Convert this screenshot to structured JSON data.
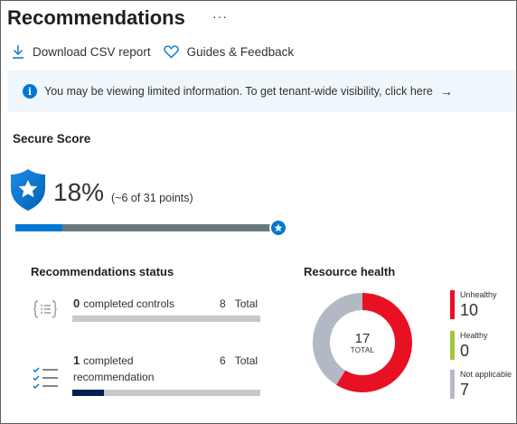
{
  "header": {
    "title": "Recommendations",
    "more_label": "···"
  },
  "toolbar": {
    "download_label": "Download CSV report",
    "guides_label": "Guides & Feedback"
  },
  "banner": {
    "info_glyph": "i",
    "text": "You may be viewing limited information. To get tenant-wide visibility, click here",
    "arrow": "→"
  },
  "secure_score": {
    "title": "Secure Score",
    "percent_label": "18%",
    "points_label": "(~6 of 31 points)",
    "progress_fraction": 0.18,
    "bar_color": "#0078d4",
    "track_color": "#69797e"
  },
  "recommendations_status": {
    "title": "Recommendations status",
    "rows": [
      {
        "count": "0",
        "label": "completed controls",
        "total": "8",
        "total_label": "Total",
        "fraction": 0
      },
      {
        "count": "1",
        "label": "completed",
        "label2": "recommendation",
        "total": "6",
        "total_label": "Total",
        "fraction": 0.1667
      }
    ]
  },
  "resource_health": {
    "title": "Resource health",
    "total": "17",
    "total_label": "TOTAL",
    "legend": [
      {
        "label": "Unhealthy",
        "value": "10",
        "color": "#e81123"
      },
      {
        "label": "Healthy",
        "value": "0",
        "color": "#a4c639"
      },
      {
        "label": "Not applicable",
        "value": "7",
        "color": "#b3b9c4"
      }
    ]
  }
}
